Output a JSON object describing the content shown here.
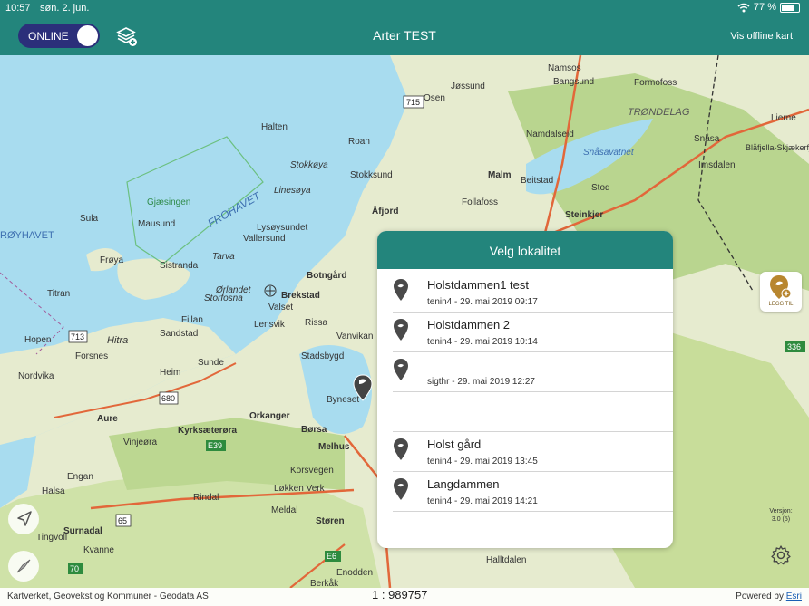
{
  "status": {
    "time": "10:57",
    "date": "søn. 2. jun.",
    "battery": "77 %",
    "battery_level": 0.77
  },
  "navbar": {
    "mode_toggle": "ONLINE",
    "title": "Arter TEST",
    "offline_maps": "Vis offline kart"
  },
  "dialog": {
    "title": "Velg lokalitet",
    "items": [
      {
        "name": "Holstdammen1 test",
        "meta": "tenin4 - 29. mai 2019 09:17",
        "has_pin": true
      },
      {
        "name": "Holstdammen 2",
        "meta": "tenin4 - 29. mai 2019 10:14",
        "has_pin": true
      },
      {
        "name": "",
        "meta": "sigthr - 29. mai 2019 12:27",
        "has_pin": true
      },
      {
        "name": "",
        "meta": "",
        "has_pin": false
      },
      {
        "name": "Holst gård",
        "meta": "tenin4 - 29. mai 2019 13:45",
        "has_pin": true
      },
      {
        "name": "Langdammen",
        "meta": "tenin4 - 29. mai 2019 14:21",
        "has_pin": true
      }
    ]
  },
  "map": {
    "labels": [
      "Halten",
      "Namsos",
      "Jøssund",
      "Bangsund",
      "Formofoss",
      "TRØNDELAG",
      "Osen",
      "Namdalseid",
      "Snåsavatnet",
      "Snåsa",
      "Roan",
      "Stokkøya",
      "Stokksund",
      "FROHAVET",
      "Linesøya",
      "Gjæsingen",
      "Mausund",
      "Sula",
      "RØYHAVET",
      "Åfjord",
      "Malm",
      "Beitstad",
      "Stod",
      "Follafoss",
      "Steinkjer",
      "Lysøysundet",
      "Vallersund",
      "Tarva",
      "Frøya",
      "Sistranda",
      "Titran",
      "Ørlandet",
      "Storfosna",
      "Brekstad",
      "Botngård",
      "Fillan",
      "Valset",
      "Rissa",
      "Hopen",
      "Hitra",
      "Sandstad",
      "Lensvik",
      "Stadsbygd",
      "Vanvikan",
      "Nordvika",
      "Forsnes",
      "Heim",
      "Sunde",
      "Byneset",
      "Aure",
      "Kyrksæterøra",
      "Orkanger",
      "Børsa",
      "Melhus",
      "Vinjeøra",
      "Engan",
      "Korsvegen",
      "Løkken Verk",
      "Halsa",
      "Rindal",
      "Meldal",
      "Støren",
      "Surnadal",
      "Tingvoll",
      "Kvanne",
      "Enodden",
      "Berkåk",
      "Halltdalen",
      "Imsdalen",
      "Lierne",
      "Blåfjella-Skjækerfjella nasjonalpark"
    ],
    "road_labels": [
      "715",
      "713",
      "680",
      "E39",
      "65",
      "70",
      "E6",
      "336"
    ],
    "legg_til": "LEGG TIL",
    "version_label": "Versjon:",
    "version": "3.0 (5)"
  },
  "footer": {
    "attribution": "Kartverket, Geovekst og Kommuner - Geodata AS",
    "scale": "1 : 989757",
    "powered_prefix": "Powered by ",
    "powered_brand": "Esri"
  },
  "colors": {
    "accent": "#23857c",
    "toggle_bg": "#2b2f7a",
    "sea": "#a8dcef",
    "land": "#e6ebcf",
    "forest": "#b9d58f",
    "road": "#e2673a"
  }
}
